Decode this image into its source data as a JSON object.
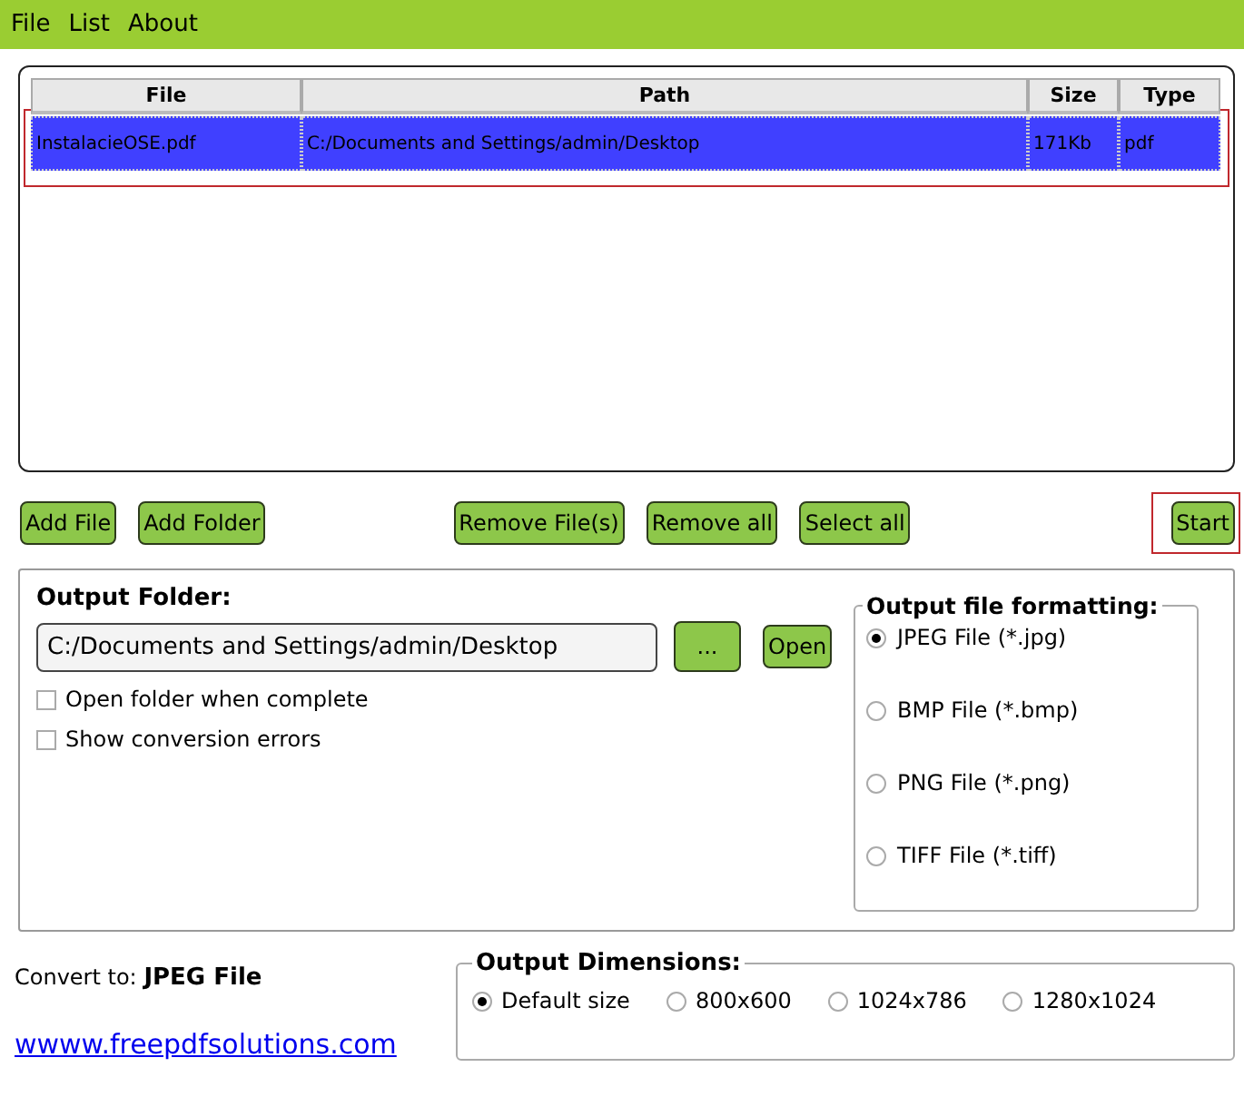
{
  "menu": [
    "File",
    "List",
    "About"
  ],
  "file_list": {
    "columns": [
      "File",
      "Path",
      "Size",
      "Type"
    ],
    "rows": [
      {
        "cells": [
          "InstalacieOSE.pdf",
          "C:/Documents and Settings/admin/Desktop",
          "171Kb",
          "pdf"
        ],
        "selected": true,
        "highlighted": true
      }
    ]
  },
  "toolbar": {
    "left": [
      {
        "label": "Add File",
        "highlighted": false
      },
      {
        "label": "Add Folder",
        "highlighted": false
      }
    ],
    "middle": [
      {
        "label": "Remove File(s)",
        "highlighted": false
      },
      {
        "label": "Remove all",
        "highlighted": false
      },
      {
        "label": "Select all",
        "highlighted": false
      }
    ],
    "right": [
      {
        "label": "Start",
        "highlighted": true
      }
    ]
  },
  "output": {
    "folder_label": "Output Folder:",
    "folder_value": "C:/Documents and Settings/admin/Desktop",
    "browse_button": "...",
    "open_button": "Open",
    "options": [
      {
        "label": "Open folder when complete",
        "checked": false
      },
      {
        "label": "Show conversion errors",
        "checked": false
      }
    ],
    "formatting": {
      "title": "Output file formatting:",
      "choices": [
        {
          "label": "JPEG File (*.jpg)",
          "selected": true
        },
        {
          "label": "BMP File (*.bmp)",
          "selected": false
        },
        {
          "label": "PNG File (*.png)",
          "selected": false
        },
        {
          "label": "TIFF File (*.tiff)",
          "selected": false
        }
      ]
    }
  },
  "convert_to": {
    "label": "Convert to:",
    "value": "JPEG File"
  },
  "link": "wwww.freepdfsolutions.com",
  "dimensions": {
    "title": "Output Dimensions:",
    "choices": [
      {
        "label": "Default size",
        "selected": true
      },
      {
        "label": "800x600",
        "selected": false
      },
      {
        "label": "1024x786",
        "selected": false
      },
      {
        "label": "1280x1024",
        "selected": false
      }
    ]
  }
}
